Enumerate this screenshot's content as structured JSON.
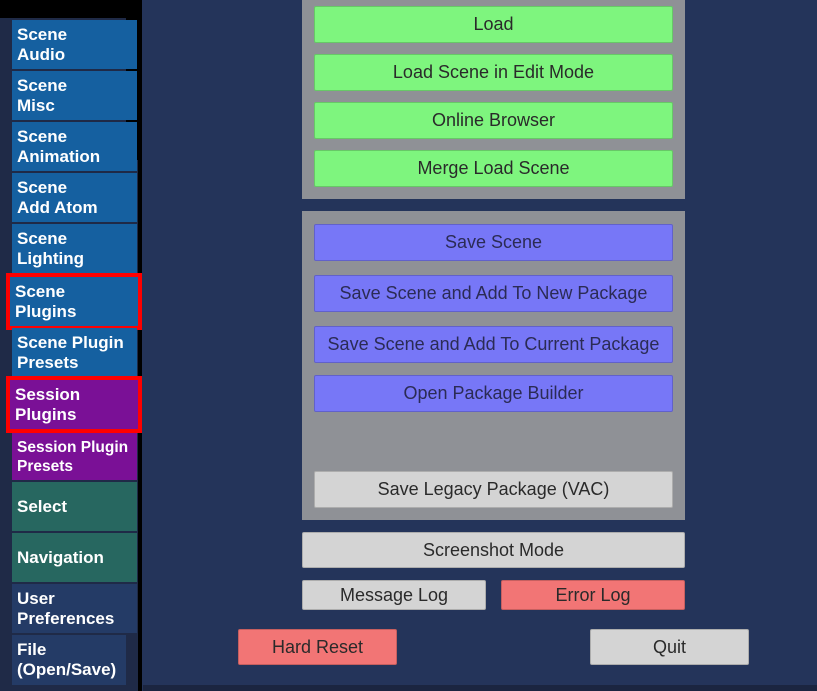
{
  "sidebar": {
    "items": [
      {
        "label": "Scene\nAudio"
      },
      {
        "label": "Scene\nMisc"
      },
      {
        "label": "Scene\nAnimation"
      },
      {
        "label": "Scene\nAdd Atom"
      },
      {
        "label": "Scene\nLighting"
      },
      {
        "label": "Scene\nPlugins"
      },
      {
        "label": "Scene Plugin\nPresets"
      },
      {
        "label": "Session\nPlugins"
      },
      {
        "label": "Session Plugin\nPresets"
      },
      {
        "label": "Select"
      },
      {
        "label": "Navigation"
      },
      {
        "label": "User\nPreferences"
      },
      {
        "label": "File\n(Open/Save)"
      }
    ]
  },
  "load_group": {
    "load": "Load",
    "load_edit": "Load Scene in Edit Mode",
    "online_browser": "Online Browser",
    "merge_load": "Merge Load Scene"
  },
  "save_group": {
    "save_scene": "Save Scene",
    "save_new_package": "Save Scene and Add To New Package",
    "save_current_package": "Save Scene and Add To Current Package",
    "open_package_builder": "Open Package Builder",
    "save_legacy": "Save Legacy Package (VAC)"
  },
  "actions": {
    "screenshot_mode": "Screenshot Mode",
    "message_log": "Message Log",
    "error_log": "Error Log",
    "hard_reset": "Hard Reset",
    "quit": "Quit"
  },
  "colors": {
    "load_green": "#7ef57e",
    "save_blue": "#7777f7",
    "neutral_gray": "#d4d4d4",
    "danger_red": "#f27575",
    "highlight_red": "#ff0000"
  }
}
